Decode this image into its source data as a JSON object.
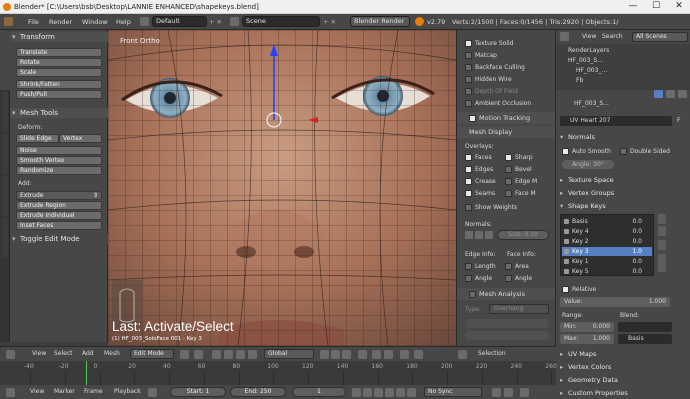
{
  "window": {
    "title": "Blender* [C:\\Users\\bsb\\Desktop\\LANNIE ENHANCED\\shapekeys.blend]",
    "minimize": "—",
    "maximize": "☐",
    "close": "✕"
  },
  "info_header": {
    "menus": [
      "File",
      "Render",
      "Window",
      "Help"
    ],
    "screen": "Default",
    "scene": "Scene",
    "engine": "Blender Render",
    "version": "v2.79",
    "stats": "Verts:2/1500 | Faces:0/1456 | Tris:2920 | Objects:1/"
  },
  "tool_shelf": {
    "transform": {
      "title": "Transform",
      "buttons": [
        "Translate",
        "Rotate",
        "Scale",
        "Shrink/Fatten",
        "Push/Pull"
      ]
    },
    "mesh_tools": {
      "title": "Mesh Tools",
      "deform_label": "Deform:",
      "deform_buttons": [
        "Slide Edge",
        "Vertex"
      ],
      "buttons": [
        "Noise",
        "Smooth Vertex",
        "Randomize"
      ],
      "add_label": "Add:",
      "extrude_dropdown": "Extrude",
      "add_buttons": [
        "Extrude Region",
        "Extrude Individual",
        "Inset Faces"
      ]
    },
    "toggle_editmode": "Toggle Edit Mode",
    "tabs": [
      "Tools",
      "Create",
      "Relations",
      "Animation",
      "Physics",
      "Grease Pencil"
    ]
  },
  "viewport": {
    "label": "Front Ortho",
    "last_operator": "Last: Activate/Select",
    "object_info": "(1) HF_003_SoloFace 001 : Key 3"
  },
  "properties": {
    "display_items_top": [
      {
        "label": "Texture Solid",
        "checked": true
      },
      {
        "label": "Matcap",
        "checked": false
      },
      {
        "label": "Backface Culling",
        "checked": false
      },
      {
        "label": "Hidden Wire",
        "checked": false
      },
      {
        "label": "Depth Of Field",
        "checked": false
      },
      {
        "label": "Ambient Occlusion",
        "checked": false
      }
    ],
    "motion_tracking": "Motion Tracking",
    "mesh_display": {
      "title": "Mesh Display",
      "overlays_label": "Overlays:",
      "left": [
        {
          "label": "Faces",
          "checked": true
        },
        {
          "label": "Edges",
          "checked": true
        },
        {
          "label": "Crease",
          "checked": true
        },
        {
          "label": "Seams",
          "checked": true
        },
        {
          "label": "Show Weights",
          "checked": false
        }
      ],
      "right": [
        {
          "label": "Sharp",
          "checked": true
        },
        {
          "label": "Bevel",
          "checked": false
        },
        {
          "label": "Edge M",
          "checked": false
        },
        {
          "label": "Face M",
          "checked": false
        }
      ],
      "normals_label": "Normals:",
      "size_label": "Size:",
      "size_value": "0.10",
      "edge_info": "Edge Info:",
      "face_info": "Face Info:",
      "edge_items": [
        "Length",
        "Angle"
      ],
      "face_items": [
        "Area",
        "Angle"
      ]
    },
    "mesh_analysis": "Mesh Analysis",
    "type_label": "Type:",
    "type_value": "Overhang"
  },
  "outliner": {
    "menus": [
      "View",
      "Search",
      "All Scenes"
    ],
    "items": [
      "RenderLayers",
      "HF_003_S...",
      "HF_003_...",
      "Fb"
    ]
  },
  "data_panel": {
    "object_name": "HF_003_S...",
    "mesh_name": "UV Heart 207",
    "f_label": "F",
    "normals": {
      "title": "Normals",
      "auto_smooth": "Auto Smooth",
      "double_sided": "Double Sided",
      "angle": "Angle: 30°"
    },
    "texture_space": "Texture Space",
    "vertex_groups": "Vertex Groups",
    "shape_keys": {
      "title": "Shape Keys",
      "keys": [
        {
          "name": "Basis",
          "value": "0.0"
        },
        {
          "name": "Key 4",
          "value": "0.0"
        },
        {
          "name": "Key 2",
          "value": "0.0"
        },
        {
          "name": "Key 3",
          "value": "1.0"
        },
        {
          "name": "Key 1",
          "value": "0.0"
        },
        {
          "name": "Key 5",
          "value": "0.0"
        }
      ],
      "relative": "Relative",
      "value_label": "Value:",
      "value": "1.000",
      "range_label": "Range:",
      "blend_label": "Blend:",
      "min": "Min:",
      "min_value": "0.000",
      "max": "Max:",
      "max_value": "1.000",
      "basis": "Basis"
    },
    "uv_maps": "UV Maps",
    "vertex_colors": "Vertex Colors",
    "geometry_data": "Geometry Data",
    "custom_properties": "Custom Properties"
  },
  "viewport_header": {
    "menus": [
      "View",
      "Select",
      "Add",
      "Mesh"
    ],
    "mode": "Edit Mode",
    "pivot": "Global",
    "right": "Selection"
  },
  "timeline": {
    "ticks": [
      "-40",
      "-20",
      "0",
      "20",
      "40",
      "60",
      "80",
      "100",
      "120",
      "140",
      "160",
      "180",
      "200",
      "220",
      "240",
      "260"
    ],
    "current_frame_fraction": 0.154
  },
  "timeline_header": {
    "menus": [
      "View",
      "Marker",
      "Frame",
      "Playback"
    ],
    "start_label": "Start:",
    "start": "1",
    "end_label": "End:",
    "end": "250",
    "current": "1",
    "sync": "No Sync"
  },
  "colors": {
    "accent_blue": "#5680c2",
    "blender_orange": "#e87d0d",
    "panel": "#474747"
  }
}
